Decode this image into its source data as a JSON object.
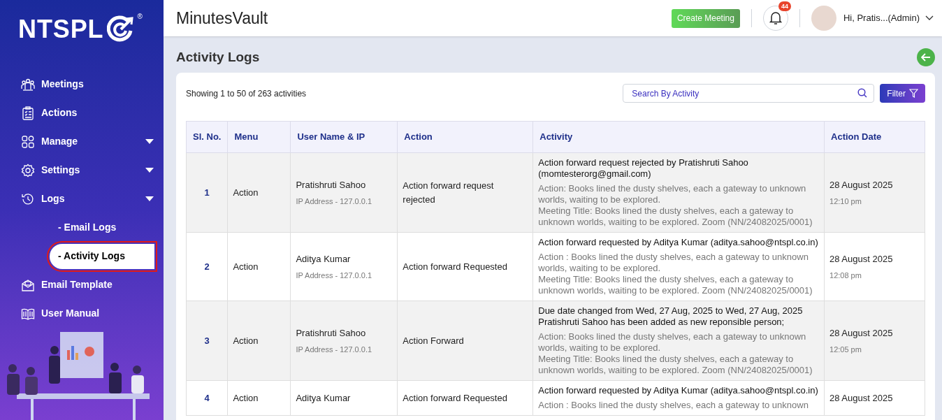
{
  "sidebar": {
    "logo": {
      "text": "NTSPL",
      "mark": "®"
    },
    "items": [
      {
        "label": "Meetings",
        "has_submenu": false,
        "selected": false
      },
      {
        "label": "Actions",
        "has_submenu": false,
        "selected": false
      },
      {
        "label": "Manage",
        "has_submenu": true,
        "selected": false
      },
      {
        "label": "Settings",
        "has_submenu": true,
        "selected": false
      },
      {
        "label": "Logs",
        "has_submenu": true,
        "selected": false,
        "children": [
          {
            "label": "- Email Logs",
            "selected": false
          },
          {
            "label": "- Activity Logs",
            "selected": true
          }
        ]
      },
      {
        "label": "Email Template",
        "has_submenu": false,
        "selected": false
      },
      {
        "label": "User Manual",
        "has_submenu": false,
        "selected": false
      }
    ]
  },
  "header": {
    "app_title": "MinutesVault",
    "create_button": "Create Meeting",
    "notification_count": "44",
    "user_label": "Hi, Pratis...(Admin)"
  },
  "page": {
    "title": "Activity Logs",
    "summary": "Showing 1 to 50 of 263 activities",
    "search": {
      "placeholder": "Search By Activity"
    },
    "filter_button": "Filter"
  },
  "table": {
    "columns": [
      "Sl. No.",
      "Menu",
      "User Name & IP",
      "Action",
      "Activity",
      "Action Date"
    ],
    "rows": [
      {
        "sl": "1",
        "menu": "Action",
        "user": "Pratishruti Sahoo",
        "ip": "IP Address - 127.0.0.1",
        "action": "Action forward request rejected",
        "headline": [
          "Action forward request rejected by Pratishruti Sahoo (momtesterorg@gmail.com)"
        ],
        "details": [
          "Action: Books lined the dusty shelves, each a gateway to unknown worlds, waiting to be explored.",
          "Meeting Title: Books lined the dusty shelves, each a gateway to unknown worlds, waiting to be explored. Zoom (NN/24082025/0001)"
        ],
        "date": "28 August 2025",
        "time": "12:10 pm"
      },
      {
        "sl": "2",
        "menu": "Action",
        "user": "Aditya Kumar",
        "ip": "IP Address - 127.0.0.1",
        "action": "Action forward Requested",
        "headline": [
          "Action forward requested by Aditya Kumar (aditya.sahoo@ntspl.co.in)"
        ],
        "details": [
          "Action : Books lined the dusty shelves, each a gateway to unknown worlds, waiting to be explored.",
          "Meeting Title: Books lined the dusty shelves, each a gateway to unknown worlds, waiting to be explored. Zoom (NN/24082025/0001)"
        ],
        "date": "28 August 2025",
        "time": "12:08 pm"
      },
      {
        "sl": "3",
        "menu": "Action",
        "user": "Pratishruti Sahoo",
        "ip": "IP Address - 127.0.0.1",
        "action": "Action Forward",
        "headline": [
          "Due date changed from Wed, 27 Aug, 2025 to Wed, 27 Aug, 2025",
          "Pratishruti Sahoo has been added as new reponsible person;"
        ],
        "details": [
          "Action: Books lined the dusty shelves, each a gateway to unknown worlds, waiting to be explored.",
          "Meeting Title: Books lined the dusty shelves, each a gateway to unknown worlds, waiting to be explored. Zoom (NN/24082025/0001)"
        ],
        "date": "28 August 2025",
        "time": "12:05 pm"
      },
      {
        "sl": "4",
        "menu": "Action",
        "user": "Aditya Kumar",
        "action": "Action forward Requested",
        "headline": [
          "Action forward requested by Aditya Kumar (aditya.sahoo@ntspl.co.in)"
        ],
        "details": [
          "Action : Books lined the dusty shelves, each a gateway to unknown"
        ],
        "date": "28 August 2025"
      }
    ]
  }
}
